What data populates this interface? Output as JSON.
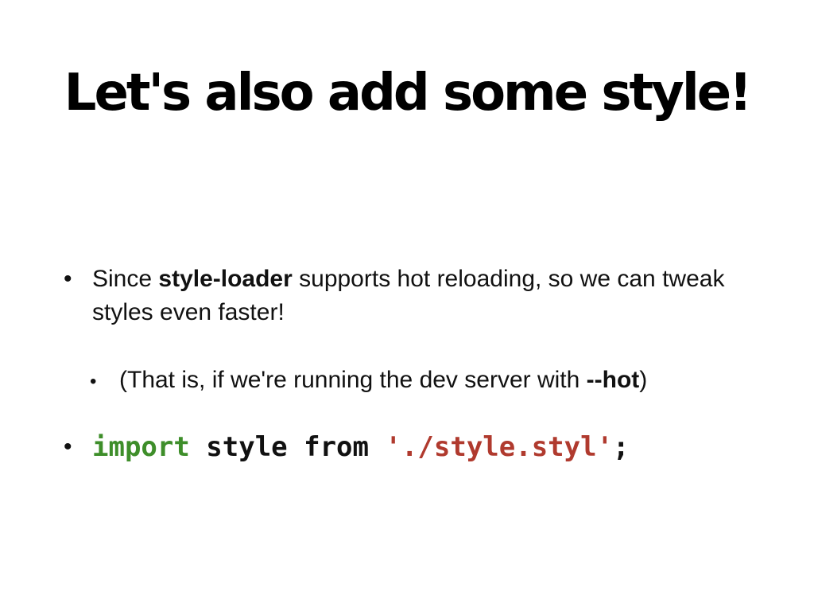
{
  "slide": {
    "title": "Let's also add some style!",
    "bullet_char": "•",
    "bullet1": {
      "pre": "Since ",
      "strong": "style-loader",
      "post": " supports hot reloading, so we can tweak styles even faster!"
    },
    "bullet2": {
      "pre": "(That is, if we're running the dev server with ",
      "strong": "--hot",
      "post": ")"
    },
    "bullet3": {
      "keyword": "import",
      "middle": " style from ",
      "string": "'./style.styl'",
      "end": ";"
    }
  },
  "colors": {
    "keyword": "#3e8e2a",
    "string": "#b03a2e",
    "text": "#111111",
    "background": "#ffffff"
  }
}
